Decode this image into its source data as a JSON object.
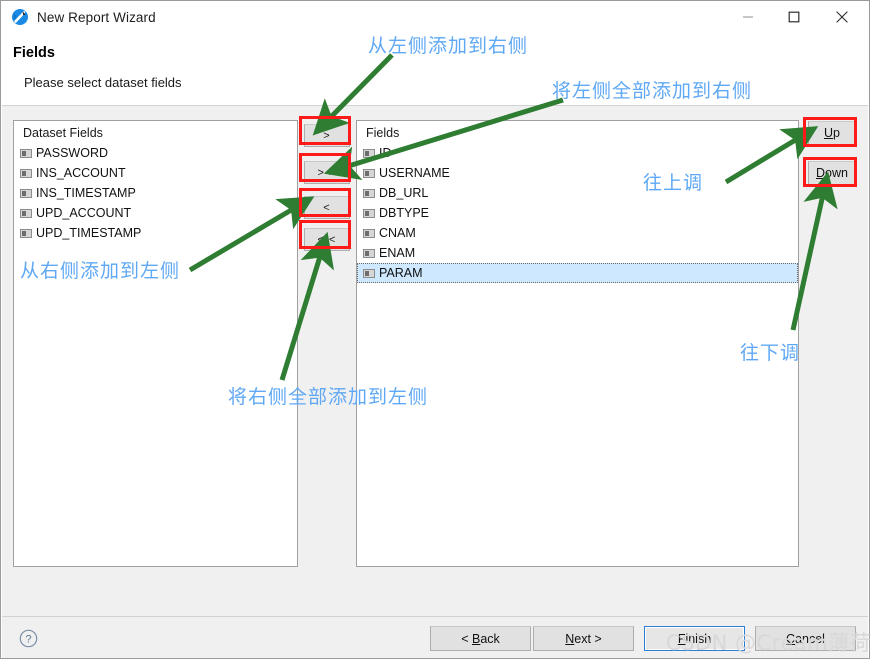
{
  "window": {
    "title": "New Report Wizard",
    "icon": "report-wizard-icon",
    "controls": {
      "minimize": "minimize-icon",
      "maximize": "maximize-icon",
      "close": "close-icon"
    }
  },
  "header": {
    "title": "Fields",
    "subtitle": "Please select dataset fields"
  },
  "left_list": {
    "header": "Dataset Fields",
    "items": [
      {
        "label": "PASSWORD",
        "selected": false
      },
      {
        "label": "INS_ACCOUNT",
        "selected": false
      },
      {
        "label": "INS_TIMESTAMP",
        "selected": false
      },
      {
        "label": "UPD_ACCOUNT",
        "selected": false
      },
      {
        "label": "UPD_TIMESTAMP",
        "selected": false
      }
    ]
  },
  "right_list": {
    "header": "Fields",
    "items": [
      {
        "label": "ID",
        "selected": false
      },
      {
        "label": "USERNAME",
        "selected": false
      },
      {
        "label": "DB_URL",
        "selected": false
      },
      {
        "label": "DBTYPE",
        "selected": false
      },
      {
        "label": "CNAM",
        "selected": false
      },
      {
        "label": "ENAM",
        "selected": false
      },
      {
        "label": "PARAM",
        "selected": true
      }
    ]
  },
  "transfer_buttons": {
    "add": ">",
    "add_all": "> >",
    "remove": "<",
    "remove_all": "< <"
  },
  "order_buttons": {
    "up": "Up",
    "up_mnemonic": "U",
    "up_rest": "p",
    "down": "Down",
    "down_mnemonic": "D",
    "down_rest": "own"
  },
  "footer": {
    "help": "?",
    "back_mnemonic_pre": "< ",
    "back_mnemonic": "B",
    "back_rest": "ack",
    "next_mnemonic": "N",
    "next_rest": "ext >",
    "finish_mnemonic": "F",
    "finish_rest": "inish",
    "cancel_mnemonic": "C",
    "cancel_rest": "ancel"
  },
  "annotations": {
    "add_left_to_right": "从左侧添加到右侧",
    "add_all_left_to_right": "将左侧全部添加到右侧",
    "add_right_to_left": "从右侧添加到左侧",
    "add_all_right_to_left": "将右侧全部添加到左侧",
    "move_up": "往上调",
    "move_down": "往下调",
    "arrow_color": "#2e7d32",
    "box_color": "#ff1a1a",
    "text_color": "#5fa8f5"
  },
  "watermark": "CSDN @Cream薄荷糖"
}
